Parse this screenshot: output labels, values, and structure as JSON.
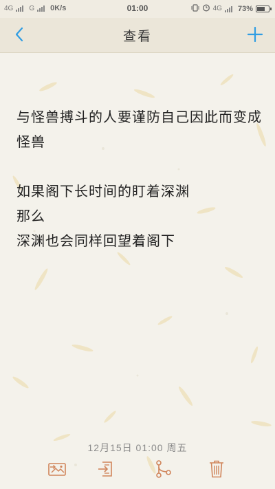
{
  "status_bar": {
    "network_1": "4G",
    "network_2": "G",
    "speed": "0K/s",
    "time": "01:00",
    "network_3": "4G",
    "battery": "73%",
    "battery_level": 0.73
  },
  "header": {
    "title": "查看",
    "back_icon": "chevron-left-icon",
    "add_icon": "plus-icon"
  },
  "note": {
    "lines": [
      "与怪兽搏斗的人要谨防自己因此而变成",
      "怪兽",
      "",
      "如果阁下长时间的盯着深渊",
      "那么",
      "深渊也会同样回望着阁下"
    ]
  },
  "footer": {
    "timestamp": "12月15日 01:00 周五"
  },
  "toolbar": {
    "items": [
      {
        "icon": "share-image-icon"
      },
      {
        "icon": "export-icon"
      },
      {
        "icon": "branch-share-icon"
      },
      {
        "icon": "trash-icon"
      }
    ]
  },
  "colors": {
    "accent": "#2f9de3",
    "toolbar_icon": "#d0845a",
    "paper": "#f4f2eb",
    "header": "#ebe6d9"
  }
}
